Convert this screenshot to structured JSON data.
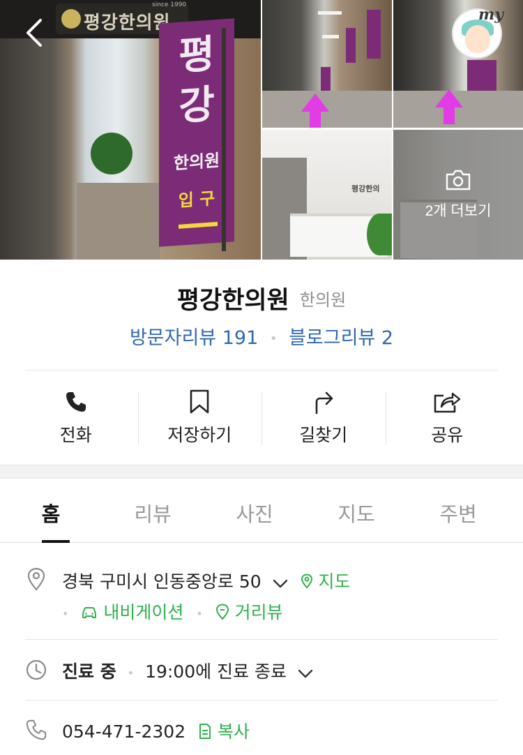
{
  "gallery": {
    "main_sign": "평강한의원",
    "main_since": "since 1990",
    "banner_big1": "평",
    "banner_big2": "강",
    "banner_mid": "한의원",
    "banner_enter": "입 구",
    "reception_logo": "평강한의",
    "more_photos_label": "2개 더보기",
    "my_label": "my"
  },
  "place": {
    "name": "평강한의원",
    "category": "한의원",
    "visitor_review": "방문자리뷰 191",
    "blog_review": "블로그리뷰 2"
  },
  "actions": [
    {
      "label": "전화",
      "icon": "phone-icon"
    },
    {
      "label": "저장하기",
      "icon": "bookmark-icon"
    },
    {
      "label": "길찾기",
      "icon": "directions-icon"
    },
    {
      "label": "공유",
      "icon": "share-icon"
    }
  ],
  "tabs": [
    {
      "label": "홈",
      "active": true
    },
    {
      "label": "리뷰",
      "active": false
    },
    {
      "label": "사진",
      "active": false
    },
    {
      "label": "지도",
      "active": false
    },
    {
      "label": "주변",
      "active": false
    }
  ],
  "info": {
    "address": "경북 구미시 인동중앙로 50",
    "map_link": "지도",
    "navigation_link": "내비게이션",
    "streetview_link": "거리뷰",
    "hours_status": "진료 중",
    "hours_detail": "19:00에 진료 종료",
    "phone": "054-471-2302",
    "copy_label": "복사"
  },
  "colors": {
    "link_blue": "#2f68b0",
    "accent_green": "#2fb14d",
    "banner_purple": "#7c2c77",
    "arrow_magenta": "#e23ce4"
  }
}
